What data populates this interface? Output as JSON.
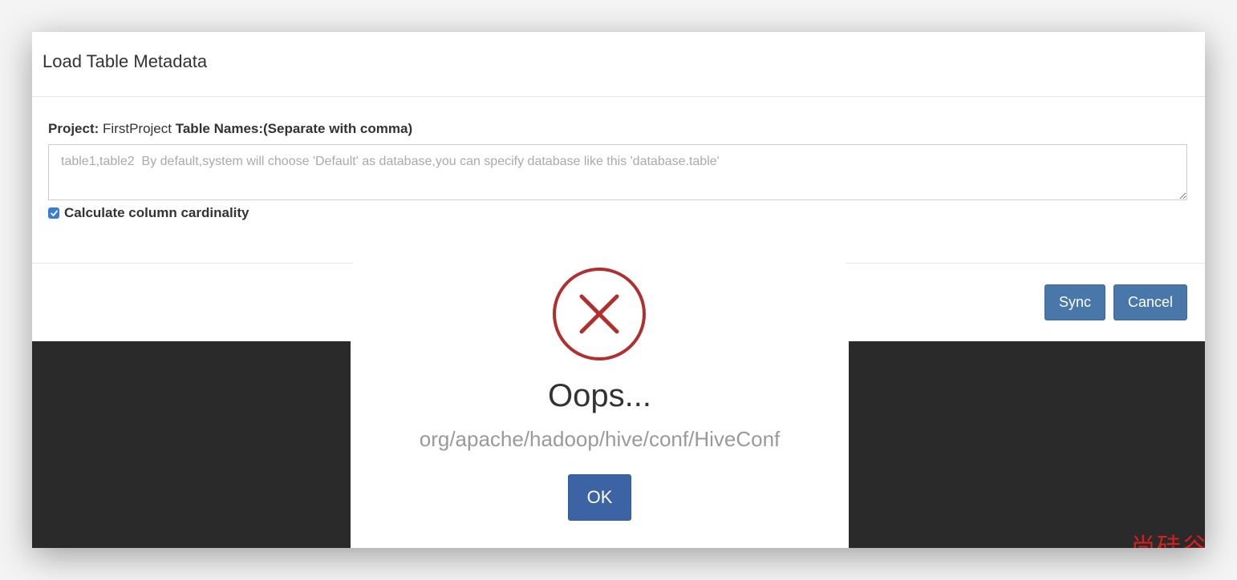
{
  "modal": {
    "title": "Load Table Metadata",
    "project_label": "Project:",
    "project_value": "FirstProject",
    "table_names_label": "Table Names:(Separate with comma)",
    "table_input_value": "",
    "table_input_placeholder": "table1,table2  By default,system will choose 'Default' as database,you can specify database like this 'database.table'",
    "calculate_cardinality_label": "Calculate column cardinality",
    "calculate_cardinality_checked": true,
    "sync_label": "Sync",
    "cancel_label": "Cancel"
  },
  "alert": {
    "icon": "error-x-circle-icon",
    "title": "Oops...",
    "message": "org/apache/hadoop/hive/conf/HiveConf",
    "ok_label": "OK"
  },
  "watermark": {
    "text": "尚硅谷"
  },
  "colors": {
    "primary_button": "#4a77a9",
    "ok_button": "#3c64a5",
    "error_red": "#b03030",
    "backdrop": "#2a2a2a"
  }
}
